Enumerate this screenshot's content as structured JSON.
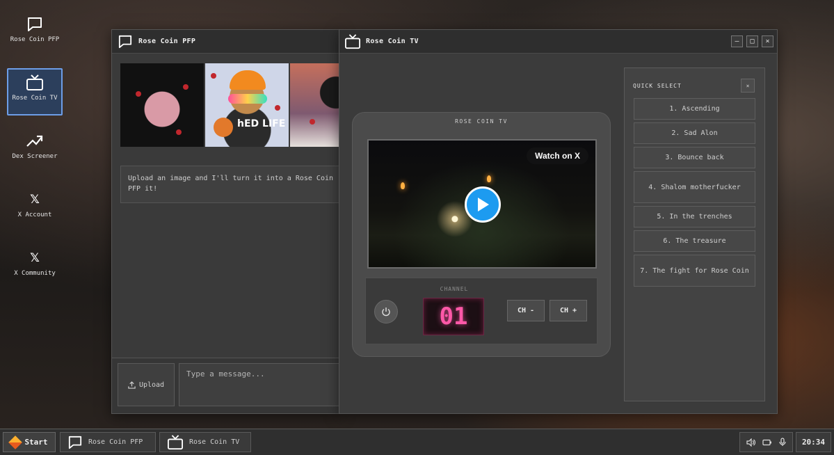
{
  "desktop": {
    "icons": [
      {
        "label": "Rose Coin PFP",
        "icon": "chat-bubble-icon"
      },
      {
        "label": "Rose Coin TV",
        "icon": "tv-icon",
        "selected": true
      },
      {
        "label": "Dex Screener",
        "icon": "trending-up-icon"
      },
      {
        "label": "X Account",
        "icon": "x-logo-icon",
        "glyph": "𝕏"
      },
      {
        "label": "X Community",
        "icon": "x-logo-icon",
        "glyph": "𝕏"
      }
    ]
  },
  "pfp_window": {
    "title": "Rose Coin PFP",
    "gallery_text": "hED LIFE",
    "bot_message": "Upload an image and I'll turn it into a Rose Coin PFP it!",
    "upload_label": "Upload",
    "input_placeholder": "Type a message..."
  },
  "tv_window": {
    "title": "Rose Coin TV",
    "controls": {
      "minimize": "–",
      "maximize": "□",
      "close": "×"
    },
    "brand": "ROSE COIN TV",
    "watch_on_x": "Watch on X",
    "channel_label": "CHANNEL",
    "channel_number": "01",
    "ch_minus": "CH -",
    "ch_plus": "CH +",
    "quick_select": {
      "title": "QUICK SELECT",
      "close": "×",
      "items": [
        "1. Ascending",
        "2. Sad Alon",
        "3. Bounce back",
        "4. Shalom motherfucker",
        "5. In the trenches",
        "6. The treasure",
        "7. The fight for Rose Coin"
      ]
    }
  },
  "taskbar": {
    "start_label": "Start",
    "tasks": [
      "Rose Coin PFP",
      "Rose Coin TV"
    ],
    "clock": "20:34"
  },
  "colors": {
    "accent_blue": "#1d9bf0",
    "channel_pink": "#ff58a8",
    "selected_icon_bg": "#2c3f5c",
    "selected_icon_border": "#6d9ee8"
  }
}
